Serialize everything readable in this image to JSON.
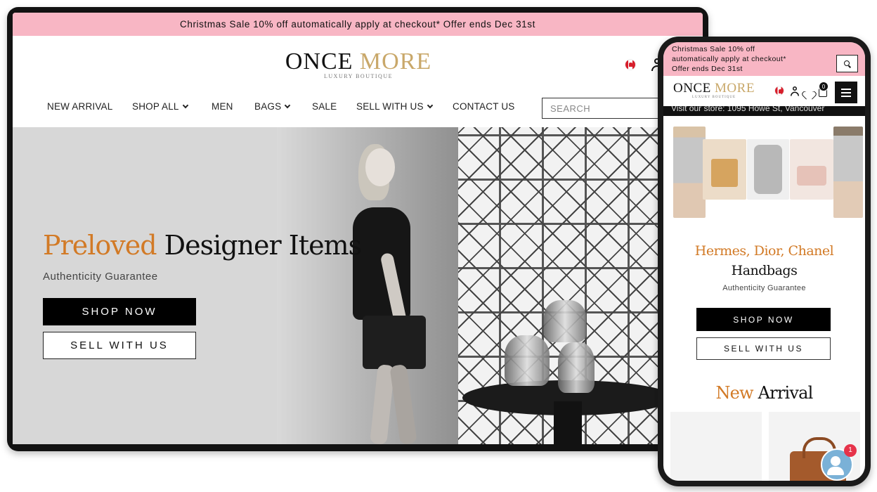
{
  "desktop": {
    "promo_text": "Christmas Sale 10% off automatically apply at checkout* Offer ends Dec 31st",
    "logo": {
      "part1": "ONCE",
      "part2": "MORE",
      "tagline": "LUXURY BOUTIQUE"
    },
    "nav": [
      {
        "label": "NEW ARRIVAL",
        "has_dropdown": false
      },
      {
        "label": "SHOP ALL",
        "has_dropdown": true
      },
      {
        "label": "MEN",
        "has_dropdown": false
      },
      {
        "label": "BAGS",
        "has_dropdown": true
      },
      {
        "label": "SALE",
        "has_dropdown": false
      },
      {
        "label": "SELL WITH US",
        "has_dropdown": true
      },
      {
        "label": "CONTACT US",
        "has_dropdown": false
      }
    ],
    "search": {
      "placeholder": "SEARCH"
    },
    "hero": {
      "title_accent": "Preloved",
      "title_rest": "Designer Items",
      "subtitle": "Authenticity Guarantee",
      "primary_button": "SHOP NOW",
      "secondary_button": "SELL WITH US"
    }
  },
  "mobile": {
    "promo_text": "Christmas Sale 10% off automatically apply at checkout* Offer ends Dec 31st",
    "logo": {
      "part1": "ONCE",
      "part2": "MORE",
      "tagline": "LUXURY BOUTIQUE"
    },
    "cart_count": "0",
    "store_text": "Visit our store: 1095 Howe St, Vancouver",
    "hero": {
      "heading_accent": "Hermes, Dior, Chanel",
      "heading_rest": "Handbags",
      "subtitle": "Authenticity Guarantee",
      "primary_button": "SHOP NOW",
      "secondary_button": "SELL WITH US"
    },
    "section_title_accent": "New",
    "section_title_rest": "Arrival",
    "chat_badge": "1"
  },
  "colors": {
    "promo_bg": "#f8b6c4",
    "accent_orange": "#d27a26",
    "logo_gold": "#c9a86a",
    "button_dark": "#000000",
    "chat_blue": "#7ab1d7",
    "badge_red": "#e6334a"
  },
  "icons": [
    "canada-flag-icon",
    "user-icon",
    "search-icon",
    "chevron-down-icon",
    "heart-icon",
    "bag-icon",
    "menu-icon",
    "chat-icon"
  ]
}
